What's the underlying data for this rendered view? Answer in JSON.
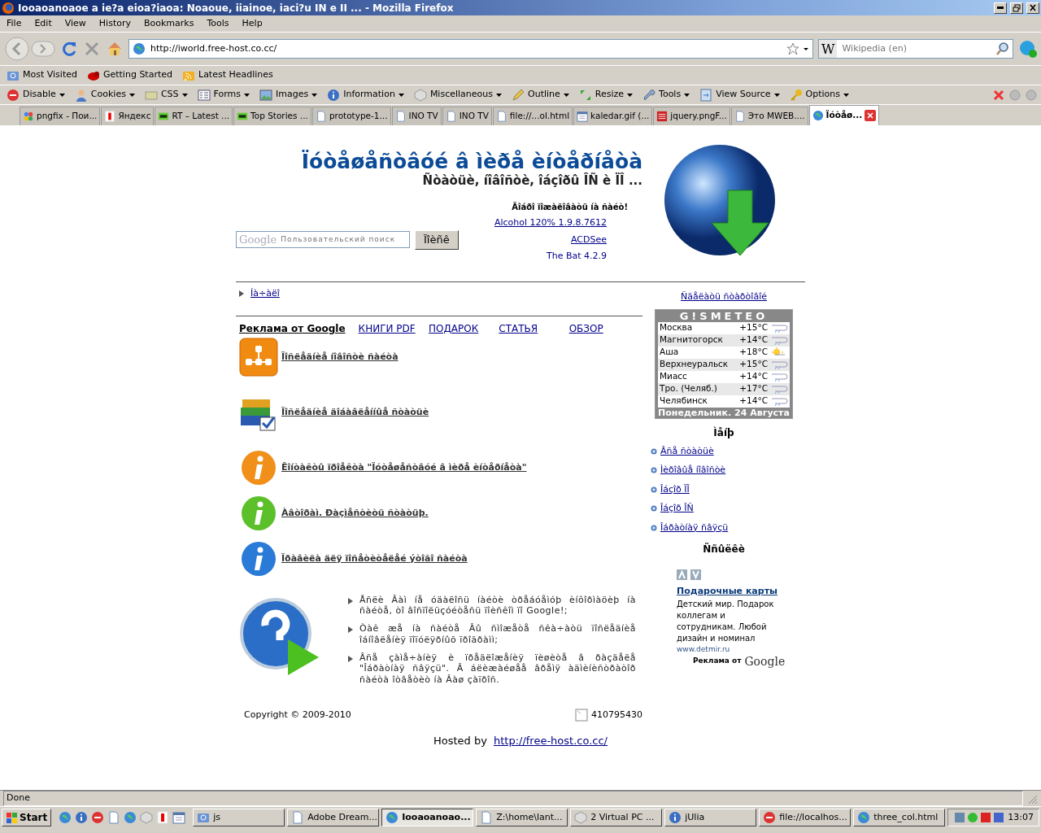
{
  "window": {
    "title": "Iooaoanoaoe a ie?a eioa?iaoa: Noaoue, iiainoe, iaci?u IN e II ... - Mozilla Firefox"
  },
  "menu": [
    "File",
    "Edit",
    "View",
    "History",
    "Bookmarks",
    "Tools",
    "Help"
  ],
  "nav": {
    "url": "http://iworld.free-host.co.cc/",
    "engine": "W",
    "search_placeholder": "Wikipedia (en)"
  },
  "bookmarks": [
    {
      "label": "Most Visited",
      "kind": "folder"
    },
    {
      "label": "Getting Started",
      "kind": "bug"
    },
    {
      "label": "Latest Headlines",
      "kind": "feed"
    }
  ],
  "dev_toolbar": [
    {
      "label": "Disable",
      "kind": "stop"
    },
    {
      "label": "Cookies",
      "kind": "person"
    },
    {
      "label": "CSS",
      "kind": "css"
    },
    {
      "label": "Forms",
      "kind": "form"
    },
    {
      "label": "Images",
      "kind": "picture"
    },
    {
      "label": "Information",
      "kind": "info"
    },
    {
      "label": "Miscellaneous",
      "kind": "cube"
    },
    {
      "label": "Outline",
      "kind": "pencil"
    },
    {
      "label": "Resize",
      "kind": "arrows"
    },
    {
      "label": "Tools",
      "kind": "wrench"
    },
    {
      "label": "View Source",
      "kind": "source"
    },
    {
      "label": "Options",
      "kind": "key"
    }
  ],
  "tabs": [
    {
      "label": "pngfix - Пои...",
      "selected": false
    },
    {
      "label": "Яндекс",
      "selected": false
    },
    {
      "label": "RT – Latest ...",
      "selected": false
    },
    {
      "label": "Top Stories ...",
      "selected": false
    },
    {
      "label": "prototype-1...",
      "selected": false
    },
    {
      "label": "INO TV",
      "selected": false
    },
    {
      "label": "INO TV",
      "selected": false
    },
    {
      "label": "file://...ol.html",
      "selected": false
    },
    {
      "label": "kaledar.gif (...",
      "selected": false
    },
    {
      "label": "jquery.pngF...",
      "selected": false
    },
    {
      "label": "Это MWEB....",
      "selected": false
    },
    {
      "label": "Ïóòåø...",
      "selected": true
    }
  ],
  "page": {
    "title": "Ïóòåøåñòâóé â ìèðå èíòåðíåòà",
    "subtitle": "Ñòàòüè, íîâîñòè, îáçîðû ÎÑ è ÏÎ ...",
    "welcome": "Äîáðî ïîæàëîâàòü íà ñàéò!",
    "search": {
      "logo": "Google",
      "placeholder": "Пользовательский поиск",
      "button": "Ïîèñê"
    },
    "software_links": [
      "Alcohol 120% 1.9.8.7612",
      "ACDSee",
      "The Bat 4.2.9"
    ],
    "home_link": "Íà÷àëî",
    "ad_links": [
      {
        "label": "Реклама от Google",
        "kind": "heading"
      },
      {
        "label": "КНИГИ PDF",
        "kind": "link"
      },
      {
        "label": "ПОДАРОК",
        "kind": "link"
      },
      {
        "label": "СТАТЬЯ",
        "kind": "link"
      },
      {
        "label": "ОБЗОР",
        "kind": "link"
      }
    ],
    "items": [
      "Ïîñëåäíèå íîâîñòè ñàéòà",
      "Ïîñëåäíèå äîáàâëåííûå ñòàòüè",
      "Êîíòàêòû ïðîåêòà \"Ïóòåøåñòâóé â ìèðå èíòåðíåòà\"",
      "Àâòîðàì. Ðàçìåñòèòü ñòàòüþ.",
      "Ïðàâèëà äëÿ ïîñåòèòåëåé ýòîãî ñàéòà"
    ],
    "notes": [
      "Åñëè Âàì íå óäàëîñü íàéòè òðåáóåìóþ èíôîðìàöèþ íà ñàéòå, òî âîñïîëüçóéòåñü ïîèñêîì ïî Google!;",
      "Òàê æå íà ñàéòå Âû ñìîæåòå ñêà÷àòü ïîñëåäíèå îáíîâëåíèÿ ïîïóëÿðíûõ ïðîãðàìì;",
      "Âñå çàìå÷àíèÿ è ïðåäëîæåíèÿ ïèøèòå â ðàçäåëå \"Îáðàòíàÿ ñâÿçü\". Â áëèæàéøåå âðåìÿ àäìèíèñòðàòîð ñàéòà îòâåòèò íà Âàø çàïðîñ."
    ],
    "copyright": "Copyright © 2009-2010",
    "counter": "410795430",
    "hosted_by": "Hosted by",
    "host_link": "http://free-host.co.cc/"
  },
  "sidebar": {
    "start_link": "Ñäåëàòü ñòàðòîâîé",
    "weather": {
      "brand": "G!SMETEO",
      "rows": [
        {
          "city": "Москва",
          "temp": "+15°C",
          "kind": "rain"
        },
        {
          "city": "Магнитогорск",
          "temp": "+14°C",
          "kind": "rain"
        },
        {
          "city": "Аша",
          "temp": "+18°C",
          "kind": "sun"
        },
        {
          "city": "Верхнеуральск",
          "temp": "+15°C",
          "kind": "rain"
        },
        {
          "city": "Миасс",
          "temp": "+14°C",
          "kind": "rain"
        },
        {
          "city": "Тро. (Челяб.)",
          "temp": "+17°C",
          "kind": "rain"
        },
        {
          "city": "Челябинск",
          "temp": "+14°C",
          "kind": "rain"
        }
      ],
      "date": "Понедельник. 24 Августа"
    },
    "menu_heading": "Ìåíþ",
    "menu": [
      "Âñå ñòàòüè",
      "Ìèðîâûå íîâîñòè",
      "Îáçîð ÏÎ",
      "Îáçîð ÎÑ",
      "Îáðàòíàÿ ñâÿçü"
    ],
    "links_heading": "Ññûëêè",
    "ad": {
      "title": "Подарочные карты",
      "text": "Детский мир. Подарок коллегам и сотрудникам. Любой дизайн и номинал",
      "url": "www.detmir.ru",
      "by": "Реклама от",
      "logo": "Google"
    }
  },
  "status_bar": "Done",
  "taskbar": {
    "start": "Start",
    "tasks": [
      {
        "label": "js",
        "selected": false
      },
      {
        "label": "Adobe Dream...",
        "selected": false
      },
      {
        "label": "Iooaoanoao...",
        "selected": true
      },
      {
        "label": "Z:\\home\\lant...",
        "selected": false
      },
      {
        "label": "2 Virtual PC ...",
        "selected": false
      },
      {
        "label": "jUlia",
        "selected": false
      },
      {
        "label": "file://localhos...",
        "selected": false
      },
      {
        "label": "three_col.html",
        "selected": false
      }
    ],
    "clock": "13:07"
  }
}
